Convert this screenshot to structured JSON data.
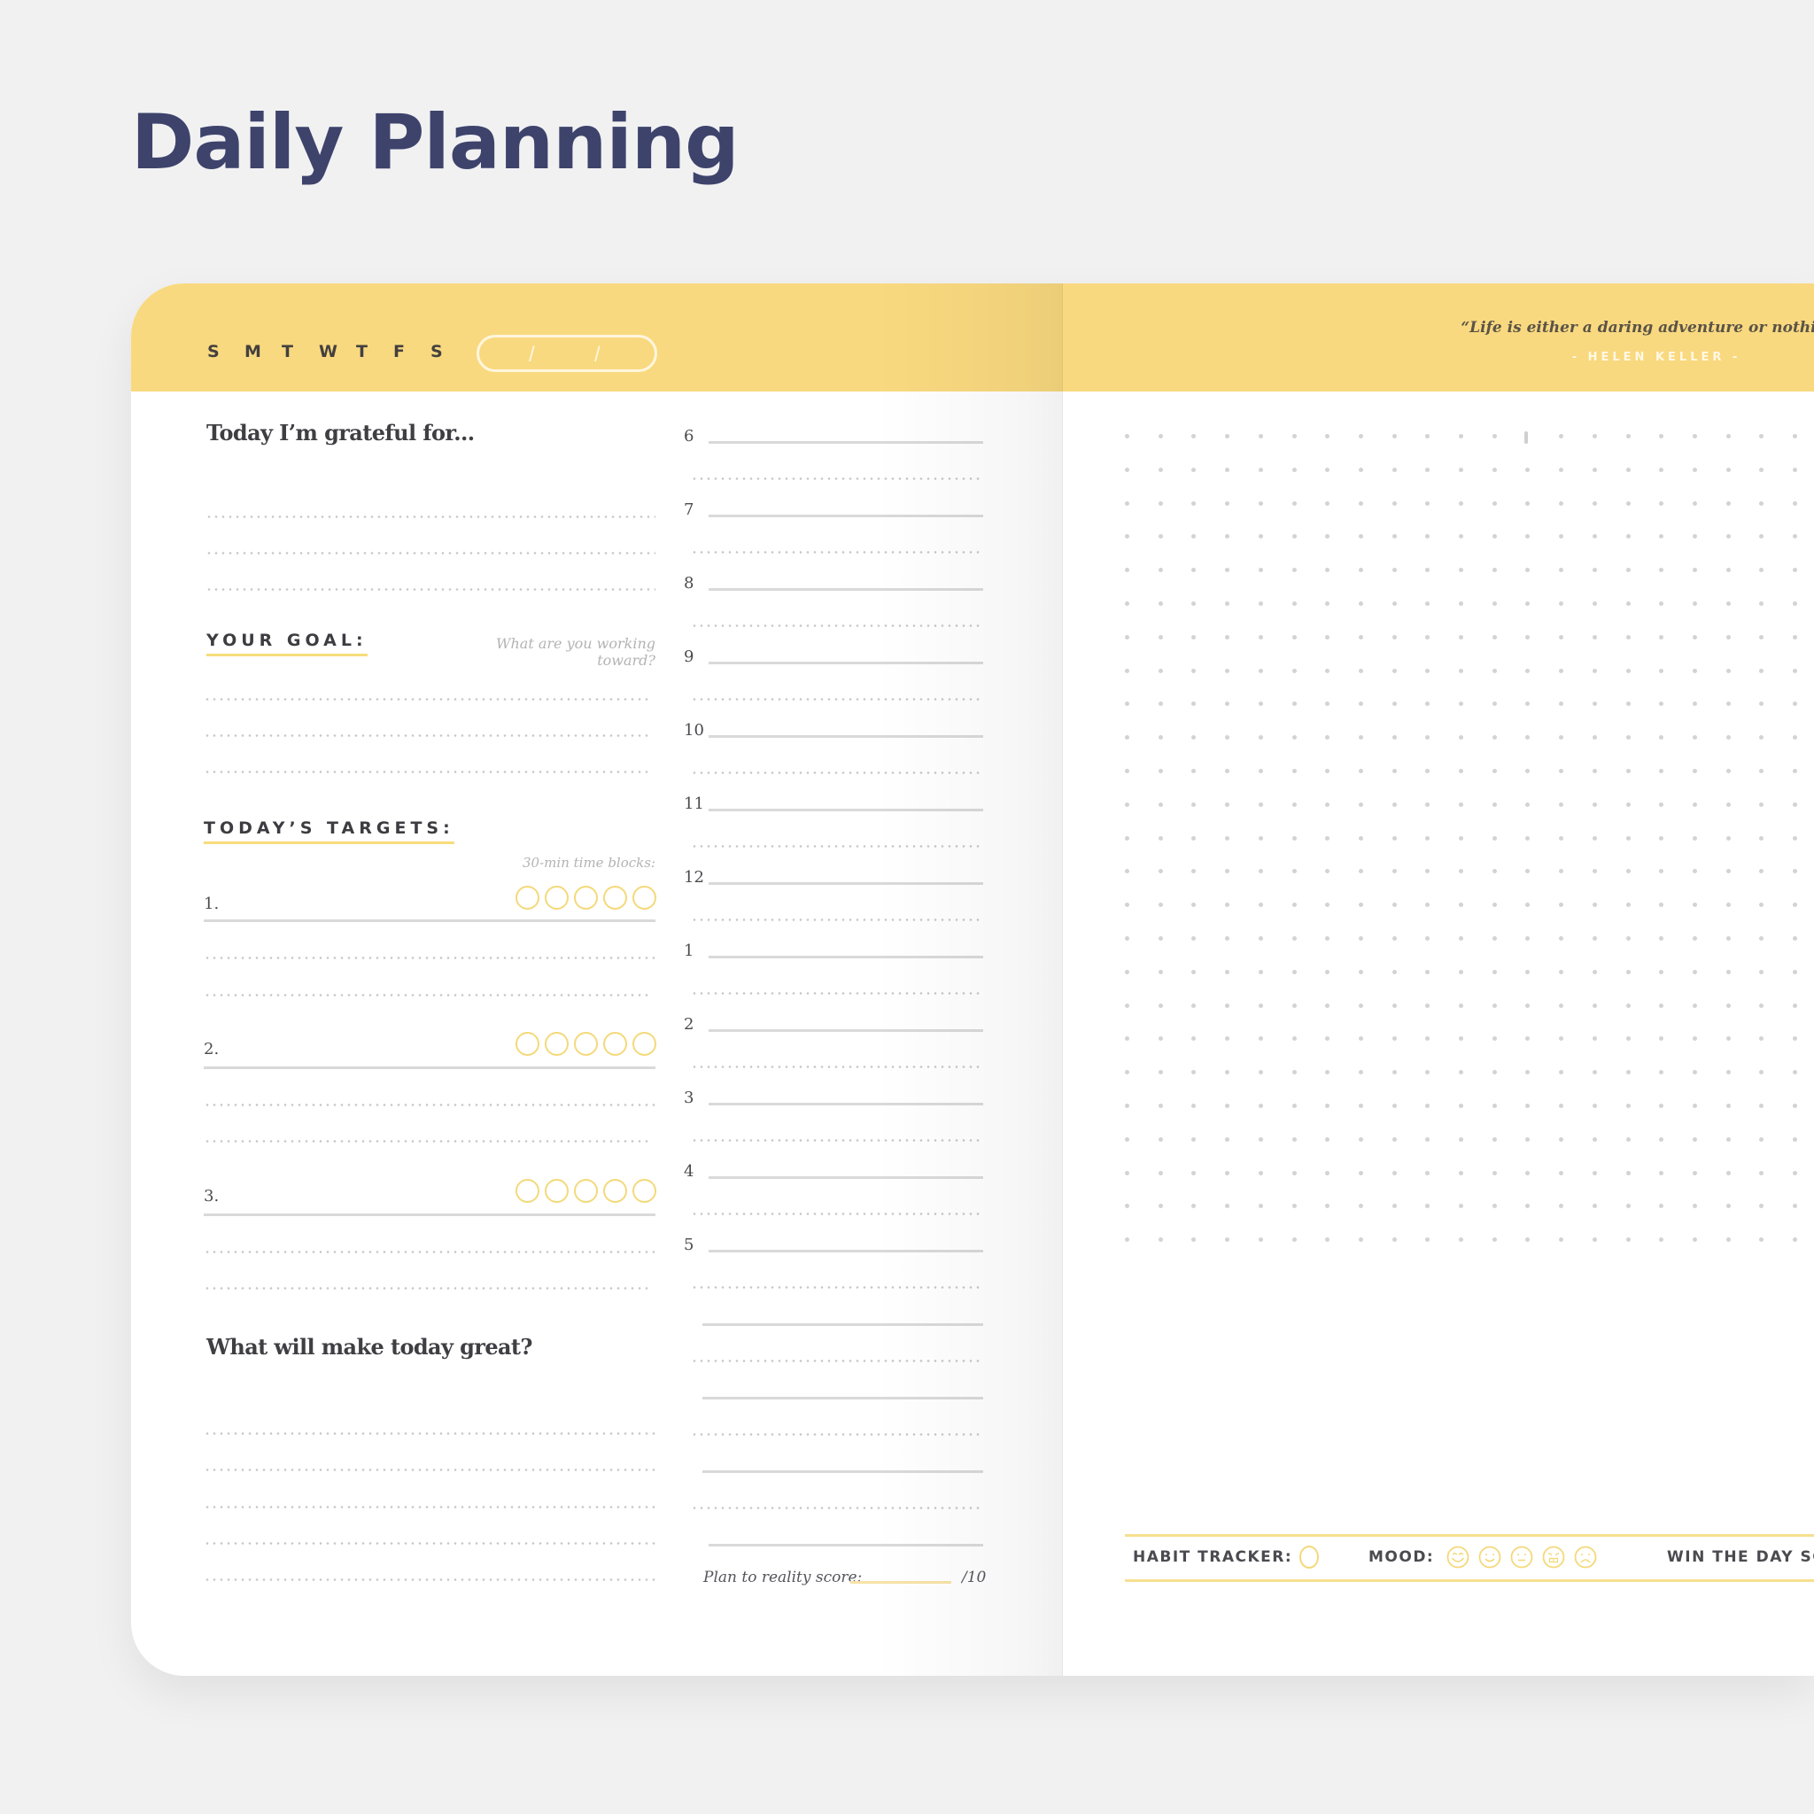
{
  "title": "Daily Planning",
  "header": {
    "days": [
      "S",
      "M",
      "T",
      "W",
      "T",
      "F",
      "S"
    ],
    "date_separators": [
      "/",
      "/"
    ],
    "quote": "“Life is either a daring adventure or nothing.”",
    "quote_author": "- HELEN KELLER -"
  },
  "left_page": {
    "grateful_heading": "Today I’m grateful for...",
    "goal_heading": "YOUR GOAL:",
    "goal_hint": "What are you working toward?",
    "targets_heading": "TODAY’S TARGETS:",
    "time_blocks_hint": "30-min time blocks:",
    "targets": [
      {
        "label": "1.",
        "time_blocks": 5
      },
      {
        "label": "2.",
        "time_blocks": 5
      },
      {
        "label": "3.",
        "time_blocks": 5
      }
    ],
    "great_heading": "What will make today great?"
  },
  "schedule": {
    "hours": [
      "6",
      "7",
      "8",
      "9",
      "10",
      "11",
      "12",
      "1",
      "2",
      "3",
      "4",
      "5"
    ],
    "score_label": "Plan to reality score:",
    "score_suffix": "/10"
  },
  "right_page": {
    "habit_label": "HABIT TRACKER:",
    "mood_label": "MOOD:",
    "moods": [
      "very-happy-face-icon",
      "happy-face-icon",
      "neutral-face-icon",
      "angry-face-icon",
      "sad-face-icon"
    ],
    "win_label": "WIN THE DAY SC"
  },
  "colors": {
    "accent_yellow": "#f9d97f",
    "title_navy": "#3d436b",
    "background": "#f1f1f2"
  }
}
